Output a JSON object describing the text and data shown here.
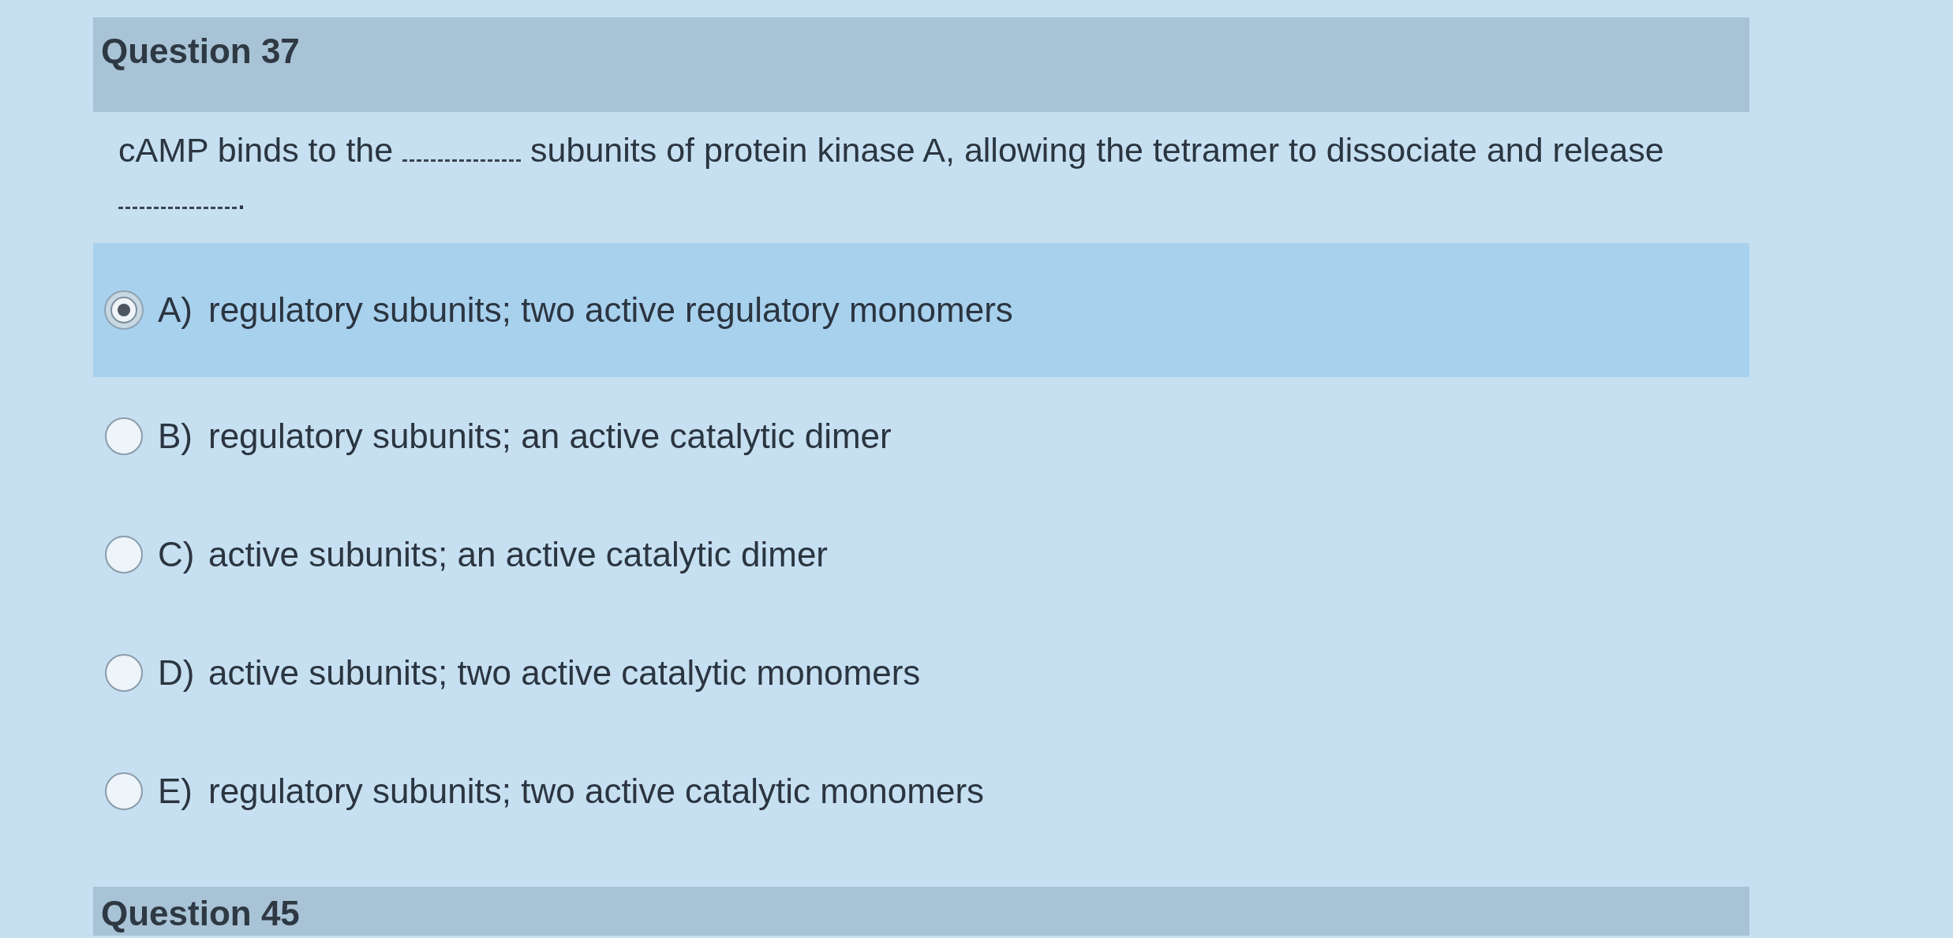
{
  "question": {
    "title": "Question 37",
    "prompt": [
      {
        "kind": "text",
        "text": "cAMP binds to the"
      },
      {
        "kind": "blank"
      },
      {
        "kind": "text",
        "text": "subunits of protein kinase A, allowing the tetramer to dissociate and release"
      },
      {
        "kind": "blank"
      },
      {
        "kind": "text",
        "text": "."
      }
    ]
  },
  "options": [
    {
      "letter": "A)",
      "text": "regulatory subunits; two active regulatory monomers",
      "selected": true
    },
    {
      "letter": "B)",
      "text": "regulatory subunits; an active catalytic dimer",
      "selected": false
    },
    {
      "letter": "C)",
      "text": "active subunits; an active catalytic dimer",
      "selected": false
    },
    {
      "letter": "D)",
      "text": "active subunits; two active catalytic monomers",
      "selected": false
    },
    {
      "letter": "E)",
      "text": "regulatory subunits; two active catalytic monomers",
      "selected": false
    }
  ],
  "next_question": {
    "title": "Question 45"
  }
}
